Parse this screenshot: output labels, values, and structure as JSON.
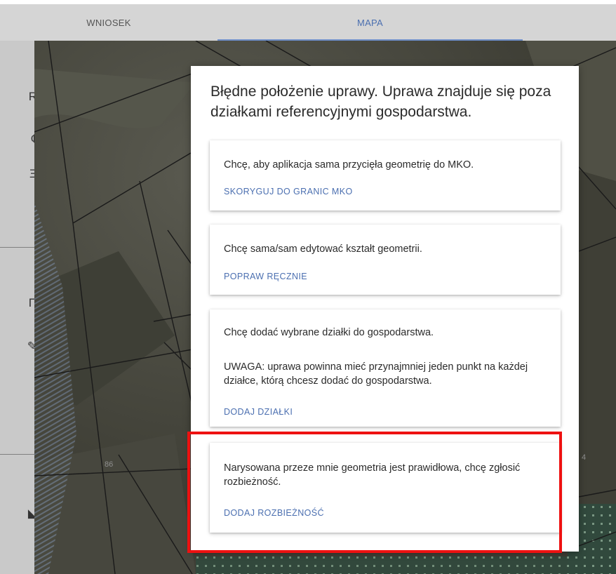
{
  "tabs": [
    {
      "label": "WNIOSEK",
      "active": false
    },
    {
      "label": "MAPA",
      "active": true
    }
  ],
  "sidebar": {
    "tools": [
      {
        "icon": "search-icon",
        "glyph": "R"
      },
      {
        "icon": "layers-icon",
        "glyph": "¢"
      },
      {
        "icon": "list-icon",
        "glyph": "Ξ"
      },
      {
        "icon": "select-area-icon",
        "glyph": "П"
      },
      {
        "icon": "edit-pencil-icon",
        "glyph": "✎"
      },
      {
        "icon": "select-frame-icon",
        "glyph": "⁞"
      },
      {
        "icon": "navigate-icon",
        "glyph": "◣"
      }
    ]
  },
  "map": {
    "parcel_labels": [
      "86",
      "4"
    ]
  },
  "dialog": {
    "title": "Błędne położenie uprawy. Uprawa znajduje się poza działkami referencyjnymi gospodarstwa.",
    "options": [
      {
        "text": "Chcę, aby aplikacja sama przycięła geometrię do MKO.",
        "action": "SKORYGUJ DO GRANIC MKO"
      },
      {
        "text": "Chcę sama/sam edytować kształt geometrii.",
        "action": "POPRAW RĘCZNIE"
      },
      {
        "text": "Chcę dodać wybrane działki do gospodarstwa.",
        "note": "UWAGA: uprawa powinna mieć przynajmniej jeden punkt na każdej działce, którą chcesz dodać do gospodarstwa.",
        "action": "DODAJ DZIAŁKI"
      },
      {
        "text": "Narysowana przeze mnie geometria jest prawidłowa, chcę zgłosić rozbieżność.",
        "action": "DODAJ ROZBIEŻNOŚĆ"
      }
    ]
  },
  "colors": {
    "accent": "#4b6fb0",
    "highlight": "#ee1111"
  }
}
